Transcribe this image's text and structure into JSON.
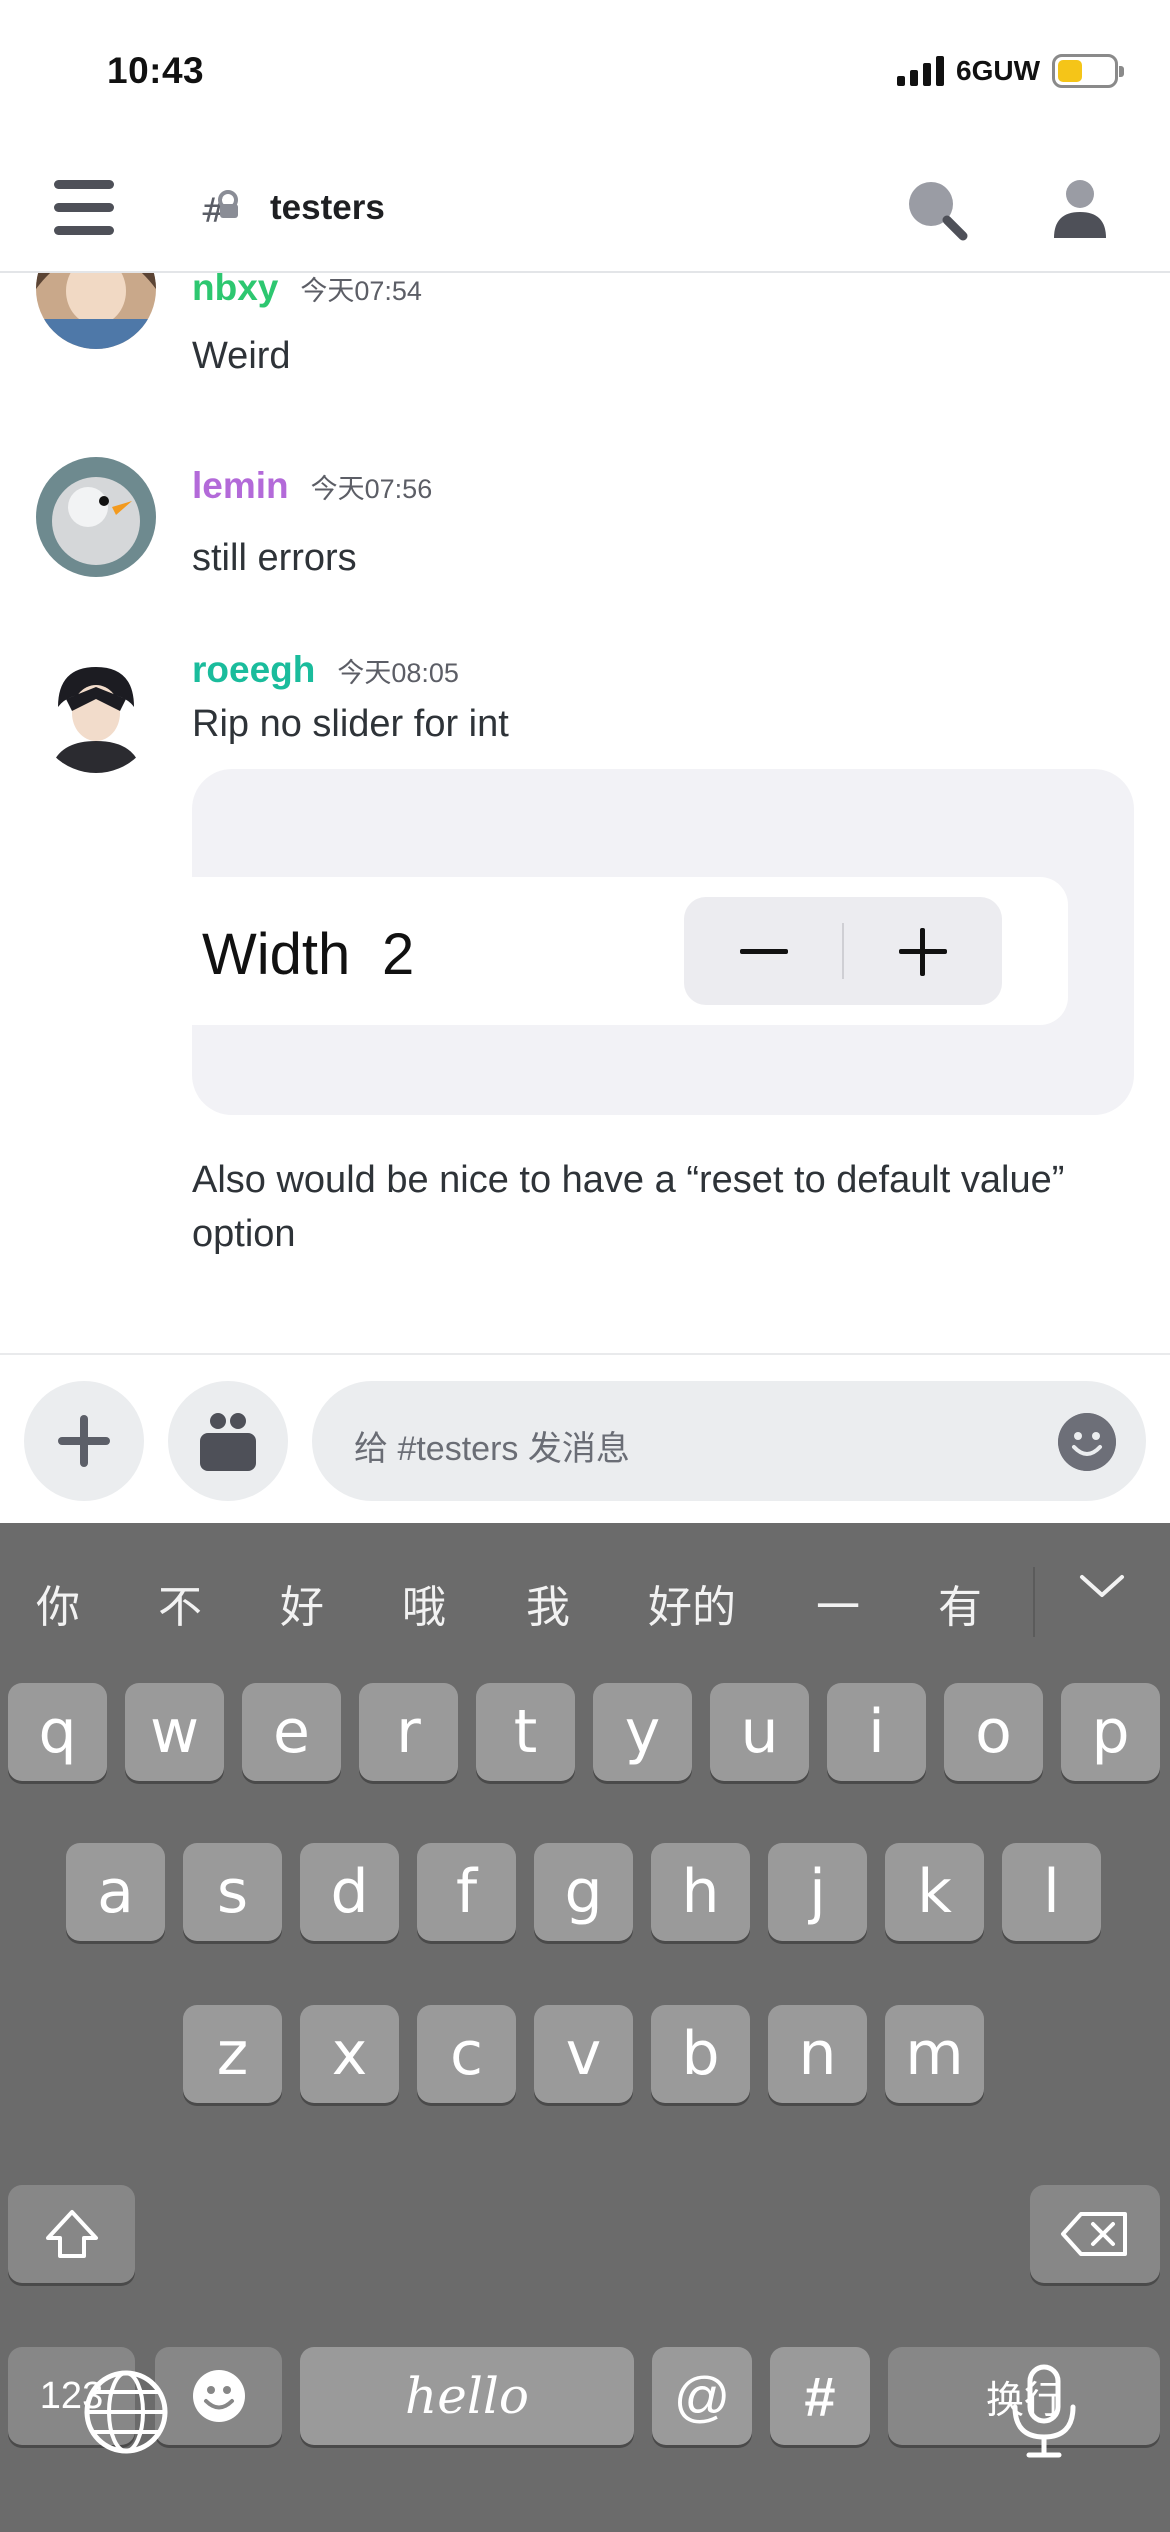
{
  "status_bar": {
    "time": "10:43",
    "network": "6GUW",
    "battery_level": 0.45,
    "battery_color": "#f5c518"
  },
  "header": {
    "channel": "testers",
    "menu_icon": "hamburger-icon",
    "search_icon": "search-icon",
    "profile_icon": "person-icon"
  },
  "messages": [
    {
      "username": "nbxy",
      "timestamp": "今天07:54",
      "text": "Weird",
      "color": "#2dc770"
    },
    {
      "username": "lemin",
      "timestamp": "今天07:56",
      "text": "still errors",
      "color": "#b36ad9"
    },
    {
      "username": "roeegh",
      "timestamp": "今天08:05",
      "text": "Rip no slider for int",
      "color": "#1abc9c"
    }
  ],
  "embed": {
    "label": "Width",
    "value": "2",
    "minus_icon": "minus-icon",
    "plus_icon": "plus-icon"
  },
  "followup_text": "Also would be nice to have a “reset to default value” option",
  "composer": {
    "placeholder": "给 #testers 发消息",
    "add_icon": "plus-icon",
    "gift_icon": "gift-icon",
    "emoji_icon": "emoji-icon"
  },
  "keyboard": {
    "candidates": [
      "你",
      "不",
      "好",
      "哦",
      "我",
      "好的",
      "一",
      "有"
    ],
    "row1": [
      "q",
      "w",
      "e",
      "r",
      "t",
      "y",
      "u",
      "i",
      "o",
      "p"
    ],
    "row2": [
      "a",
      "s",
      "d",
      "f",
      "g",
      "h",
      "j",
      "k",
      "l"
    ],
    "row3": [
      "z",
      "x",
      "c",
      "v",
      "b",
      "n",
      "m"
    ],
    "numbers_key": "123",
    "space_label": "hello",
    "at_key": "@",
    "hash_key": "#",
    "return_key": "换行"
  }
}
